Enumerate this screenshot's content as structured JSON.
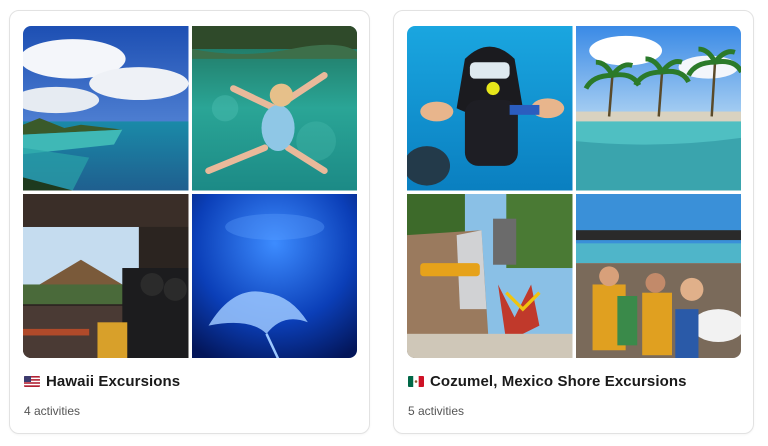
{
  "destinations": [
    {
      "title": "Hawaii Excursions",
      "count": "4 activities",
      "flag_icon": "us-flag-icon",
      "images": [
        "coastline-photo",
        "swimmer-in-lagoon-photo",
        "tour-vehicle-view-photo",
        "manta-ray-night-dive-photo"
      ]
    },
    {
      "title": "Cozumel, Mexico Shore Excursions",
      "count": "5 activities",
      "flag_icon": "mexico-flag-icon",
      "images": [
        "scuba-diver-photo",
        "palm-beach-pool-photo",
        "waterfall-park-photo",
        "open-air-tram-photo"
      ]
    }
  ]
}
